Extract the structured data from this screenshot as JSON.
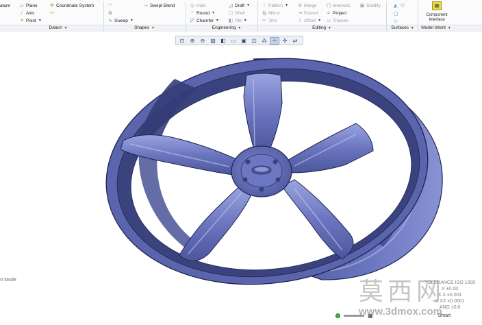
{
  "ribbon": {
    "col1": [
      "ature"
    ],
    "datum": {
      "plane": "Plane",
      "axis": "Axis",
      "point": "Point",
      "csys": "Coordinate System"
    },
    "shapes": {
      "swept_blend": "Swept Blend",
      "sweep": "Sweep"
    },
    "engineering": {
      "hole": "Hole",
      "round": "Round",
      "chamfer": "Chamfer",
      "draft": "Draft",
      "shell": "Shell",
      "rib": "Rib"
    },
    "editing": {
      "pattern": "Pattern",
      "mirror": "Mirror",
      "trim": "Trim",
      "merge": "Merge",
      "extend": "Extend",
      "offset": "Offset",
      "intersect": "Intersect",
      "project": "Project",
      "thicken": "Thicken",
      "solidify": "Solidify"
    },
    "model_intent": {
      "component_interface": "Component Interface"
    },
    "groups": {
      "datum": "Datum",
      "shapes": "Shapes",
      "engineering": "Engineering",
      "editing": "Editing",
      "surfaces": "Surfaces",
      "model_intent": "Model Intent"
    }
  },
  "viewport": {
    "mode_text": "rt Mode",
    "tolerance_lines": [
      "TOLERANCE ISO 1000",
      "X ±0.00",
      "X.X ±0.001",
      "X.XX ±0.0001",
      "ANG ±0.0"
    ]
  },
  "watermark": {
    "chars": "莫西网",
    "url": "www.3dmox.com"
  },
  "status": {
    "text": "Smart"
  },
  "colors": {
    "wheel": "#5e69b0",
    "wheel_dark": "#2e3566",
    "wheel_light": "#a9b2e6",
    "ribbon_bg": "#fbfbfc"
  }
}
